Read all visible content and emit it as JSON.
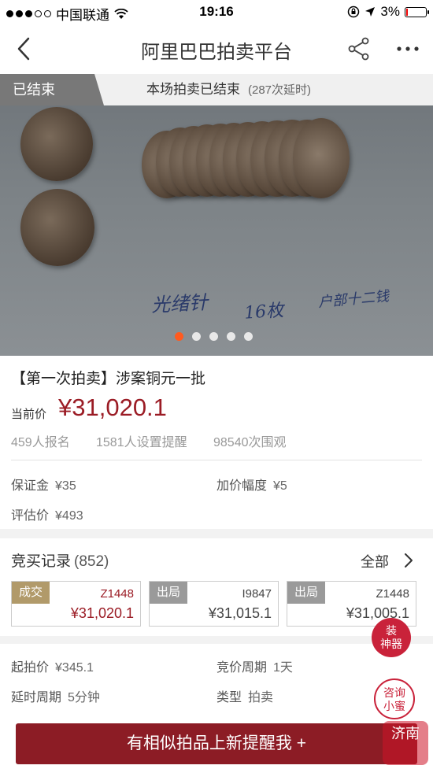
{
  "status_bar": {
    "carrier": "中国联通",
    "time": "19:16",
    "battery": "3%"
  },
  "nav": {
    "title": "阿里巴巴拍卖平台"
  },
  "auction_status": {
    "tag": "已结束",
    "message": "本场拍卖已结束",
    "extensions": "(287次延时)"
  },
  "photo": {
    "handwriting": [
      "光绪针",
      "16枚",
      "户部十二钱"
    ],
    "page_count": 5,
    "active_index": 0
  },
  "lot": {
    "title": "【第一次拍卖】涉案铜元一批",
    "current_price_label": "当前价",
    "current_price": "¥31,020.1",
    "stats": [
      "459人报名",
      "1581人设置提醒",
      "98540次围观"
    ]
  },
  "details_top": [
    {
      "label": "保证金",
      "value": "¥35"
    },
    {
      "label": "加价幅度",
      "value": "¥5"
    },
    {
      "label": "评估价",
      "value": "¥493"
    }
  ],
  "bids": {
    "heading": "竞买记录",
    "count": "(852)",
    "all_label": "全部",
    "records": [
      {
        "badge": "成交",
        "user": "Z1448",
        "amount": "¥31,020.1"
      },
      {
        "badge": "出局",
        "user": "I9847",
        "amount": "¥31,015.1"
      },
      {
        "badge": "出局",
        "user": "Z1448",
        "amount": "¥31,005.1"
      }
    ]
  },
  "details_bottom": [
    {
      "label": "起拍价",
      "value": "¥345.1"
    },
    {
      "label": "竞价周期",
      "value": "1天"
    },
    {
      "label": "延时周期",
      "value": "5分钟"
    },
    {
      "label": "类型",
      "value": "拍卖"
    }
  ],
  "float_buttons": {
    "decor": "装\n神器",
    "consult": "咨询\n小蜜"
  },
  "bottom_action": "有相似拍品上新提醒我 +",
  "watermark": "济南",
  "colors": {
    "accent": "#9b1c25",
    "pager_active": "#ff5a1f",
    "deal_badge": "#b19a6a"
  }
}
